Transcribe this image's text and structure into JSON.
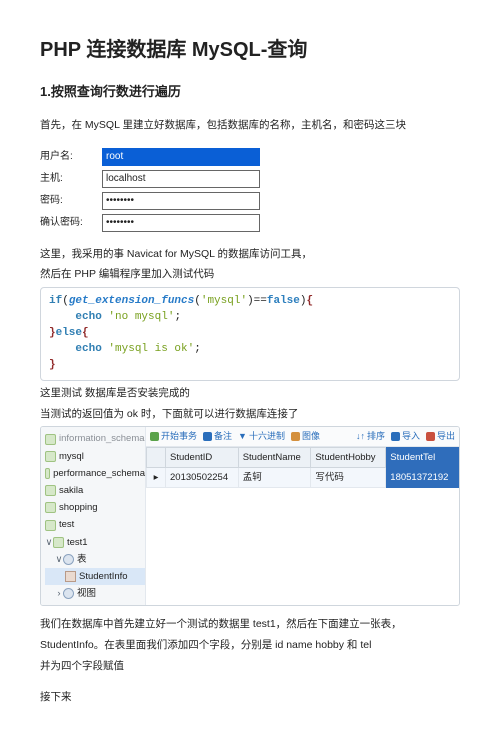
{
  "title": "PHP 连接数据库 MySQL-查询",
  "section1": "1.按照查询行数进行遍历",
  "intro": "首先，在 MySQL 里建立好数据库，包括数据库的名称，主机名，和密码这三块",
  "form": {
    "user_label": "用户名:",
    "user_value": "root",
    "host_label": "主机:",
    "host_value": "localhost",
    "pw_label": "密码:",
    "pw_value": "••••••••",
    "pw2_label": "确认密码:",
    "pw2_value": "••••••••"
  },
  "mid1": "这里，我采用的事 Navicat for MySQL 的数据库访问工具，",
  "mid2": "然后在 PHP 编辑程序里加入测试代码",
  "code": {
    "l1a": "if",
    "l1b": "(",
    "l1c": "get_extension_funcs",
    "l1d": "(",
    "l1e": "'mysql'",
    "l1f": ")==",
    "l1g": "false",
    "l1h": ")",
    "l1i": "{",
    "l2a": "echo ",
    "l2b": "'no mysql'",
    "l2c": ";",
    "l3a": "}",
    "l3b": "else",
    "l3c": "{",
    "l4a": "echo ",
    "l4b": "'mysql is ok'",
    "l4c": ";",
    "l5a": "}"
  },
  "mid3": "这里测试 数据库是否安装完成的",
  "mid4": "当测试的返回值为 ok 时，下面就可以进行数据库连接了",
  "navicat": {
    "tree": {
      "h0": "information_schema",
      "items": [
        "mysql",
        "performance_schema",
        "sakila",
        "shopping",
        "test"
      ],
      "test1": "test1",
      "tables": "表",
      "studentinfo": "StudentInfo",
      "views": "视图"
    },
    "toolbar": {
      "start": "开始事务",
      "memo": "备注",
      "hex": "十六进制",
      "img": "图像",
      "sort": "排序",
      "import": "导入",
      "export": "导出"
    },
    "grid": {
      "h_id": "StudentID",
      "h_name": "StudentName",
      "h_hobby": "StudentHobby",
      "h_tel": "StudentTel",
      "r_id": "20130502254",
      "r_name": "孟轲",
      "r_hobby": "写代码",
      "r_tel": "18051372192"
    }
  },
  "tail1": "我们在数据库中首先建立好一个测试的数据里 test1，然后在下面建立一张表，",
  "tail2": "StudentInfo。在表里面我们添加四个字段，分别是 id name hobby  和 tel",
  "tail3": "并为四个字段赋值",
  "tail4": "接下来"
}
